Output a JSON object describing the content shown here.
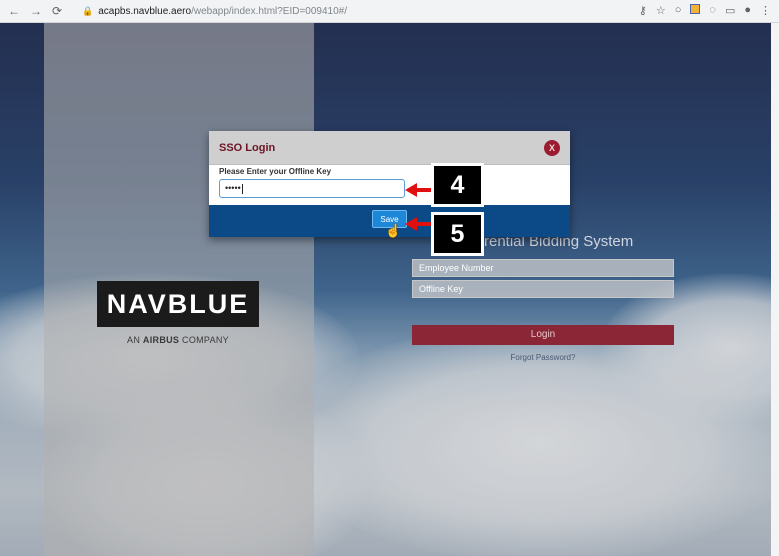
{
  "browser": {
    "url_host": "acapbs.navblue.aero",
    "url_path": "/webapp/index.html?EID=009410#/"
  },
  "background": {
    "logo_text": "NAVBLUE",
    "logo_sub_prefix": "AN ",
    "logo_sub_brand": "AIRBUS",
    "logo_sub_suffix": " COMPANY",
    "system_title": "rential Bidding System",
    "employee_placeholder": "Employee Number",
    "offline_placeholder": "Offline Key",
    "login_label": "Login",
    "forgot_label": "Forgot Password?"
  },
  "modal": {
    "title": "SSO Login",
    "close_label": "X",
    "field_label": "Please Enter your Offline Key",
    "field_value": "•••••",
    "save_label": "Save"
  },
  "annotations": {
    "step_input": "4",
    "step_save": "5",
    "arrow_color": "#e01010"
  },
  "colors": {
    "brand_maroon": "#6d1425",
    "modal_footer": "#0b4a86",
    "save_button": "#1e88d8"
  }
}
